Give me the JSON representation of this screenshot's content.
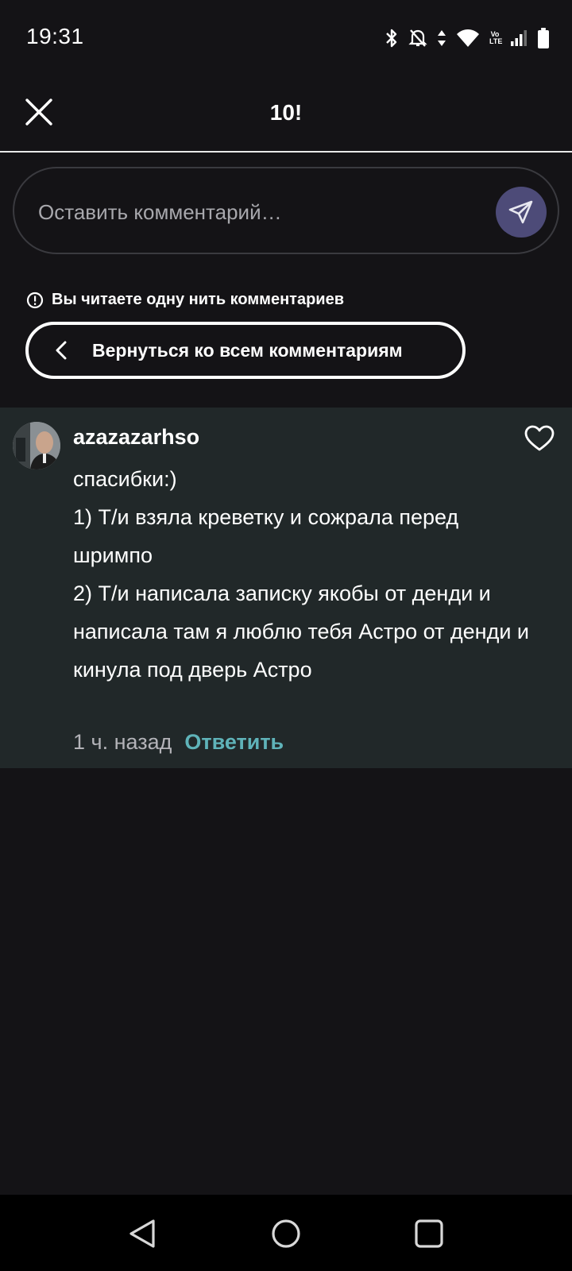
{
  "status_bar": {
    "time": "19:31",
    "icons": [
      "bluetooth-icon",
      "bell-off-icon",
      "data-arrows-icon",
      "wifi-icon",
      "volte-icon",
      "signal-icon",
      "battery-icon"
    ],
    "volte_line1": "Vo",
    "volte_line2": "LTE"
  },
  "header": {
    "title": "10!",
    "close_icon": "close-icon"
  },
  "comment_input": {
    "placeholder": "Оставить комментарий…",
    "send_icon": "send-icon",
    "send_button_color": "#4d4b78"
  },
  "thread": {
    "notice": "Вы читаете одну нить комментариев",
    "back_label": "Вернуться ко всем комментариям"
  },
  "comment": {
    "username": "azazazarhso",
    "lines": [
      "спасибки:)",
      "1) Т/и взяла креветку и сожрала перед шримпо",
      "2) Т/и написала записку якобы от денди и написала там я люблю тебя Астро от денди и кинула под дверь Астро"
    ],
    "timestamp": "1 ч. назад",
    "reply_label": "Ответить",
    "reply_color": "#5fb3b9",
    "background": "#212829"
  },
  "nav_bar": {
    "buttons": [
      "back-triangle-icon",
      "home-circle-icon",
      "recents-square-icon"
    ]
  }
}
